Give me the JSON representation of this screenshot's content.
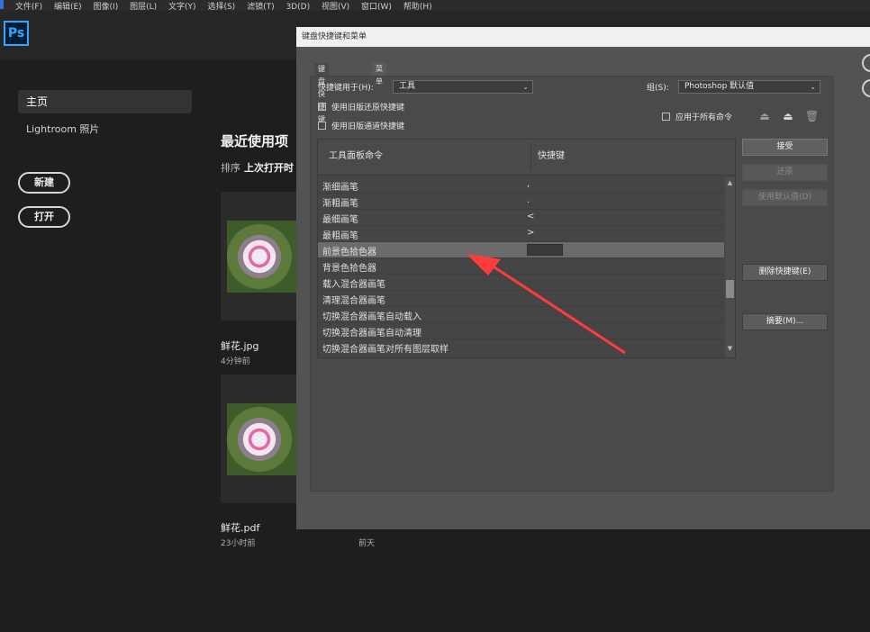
{
  "menubar": {
    "items": [
      "文件(F)",
      "编辑(E)",
      "图像(I)",
      "图层(L)",
      "文字(Y)",
      "选择(S)",
      "滤镜(T)",
      "3D(D)",
      "视图(V)",
      "窗口(W)",
      "帮助(H)"
    ]
  },
  "app": {
    "logo": "Ps"
  },
  "home": {
    "nav_home": "主页",
    "nav_lightroom": "Lightroom 照片",
    "new_button": "新建",
    "open_button": "打开",
    "recent_title": "最近使用项",
    "sort_label": "排序",
    "sort_value": "上次打开时",
    "files": [
      {
        "name": "鲜花.jpg",
        "time": "4分钟前"
      },
      {
        "name": "鲜花.pdf",
        "time": "23小时前"
      }
    ],
    "extra_time": "前天"
  },
  "dialog": {
    "title": "键盘快捷键和菜单",
    "tabs": [
      "键盘快捷键",
      "菜单"
    ],
    "shortcuts_for_label": "快捷键用于(H):",
    "shortcuts_for_value": "工具",
    "set_label": "组(S):",
    "set_value": "Photoshop 默认值",
    "legacy_undo": "使用旧版还原快捷键",
    "legacy_channel": "使用旧版通道快捷键",
    "apply_all": "应用于所有命令",
    "table": {
      "col_command": "工具面板命令",
      "col_shortcut": "快捷键",
      "rows": [
        {
          "command": "渐细画笔",
          "shortcut": ","
        },
        {
          "command": "渐粗画笔",
          "shortcut": "."
        },
        {
          "command": "最细画笔",
          "shortcut": "<"
        },
        {
          "command": "最粗画笔",
          "shortcut": ">"
        },
        {
          "command": "前景色拾色器",
          "shortcut": ""
        },
        {
          "command": "背景色拾色器",
          "shortcut": ""
        },
        {
          "command": "载入混合器画笔",
          "shortcut": ""
        },
        {
          "command": "清理混合器画笔",
          "shortcut": ""
        },
        {
          "command": "切换混合器画笔自动载入",
          "shortcut": ""
        },
        {
          "command": "切换混合器画笔自动清理",
          "shortcut": ""
        },
        {
          "command": "切换混合器画笔对所有图层取样",
          "shortcut": ""
        }
      ],
      "selected_index": 4
    },
    "buttons": {
      "accept": "接受",
      "undo": "还原",
      "use_default": "使用默认值(D)",
      "delete_shortcut": "删除快捷键(E)",
      "summarize": "摘要(M)..."
    }
  },
  "colors": {
    "annotation_arrow": "#ff3b3b",
    "dialog_bg": "#535353"
  }
}
